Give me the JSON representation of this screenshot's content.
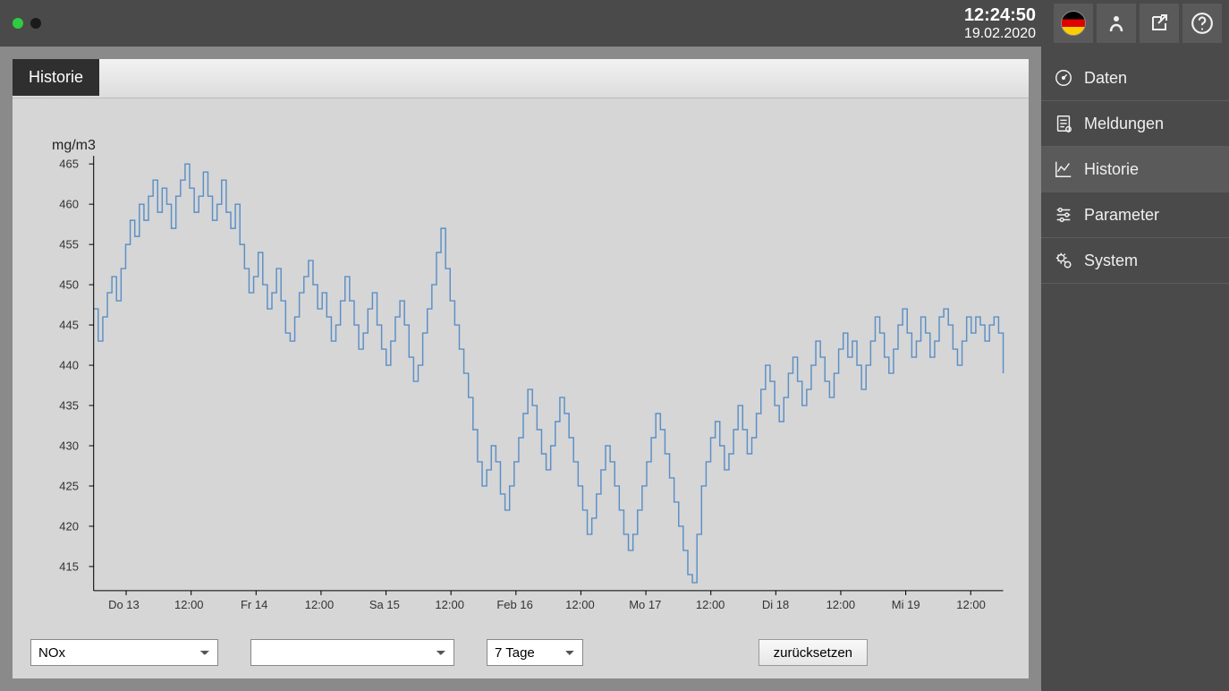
{
  "header": {
    "time": "12:24:50",
    "date": "19.02.2020"
  },
  "sidebar": {
    "items": [
      {
        "label": "Daten"
      },
      {
        "label": "Meldungen"
      },
      {
        "label": "Historie"
      },
      {
        "label": "Parameter"
      },
      {
        "label": "System"
      }
    ]
  },
  "panel": {
    "tab_label": "Historie"
  },
  "controls": {
    "select1": "NOx",
    "select2": "",
    "select3": "7 Tage",
    "reset_label": "zurücksetzen"
  },
  "chart_data": {
    "type": "line",
    "ylabel": "mg/m3",
    "ylim": [
      412,
      466
    ],
    "y_ticks": [
      415,
      420,
      425,
      430,
      435,
      440,
      445,
      450,
      455,
      460,
      465
    ],
    "x_ticks": [
      "Do 13",
      "12:00",
      "Fr 14",
      "12:00",
      "Sa 15",
      "12:00",
      "Feb 16",
      "12:00",
      "Mo 17",
      "12:00",
      "Di 18",
      "12:00",
      "Mi 19",
      "12:00"
    ],
    "x": [
      0,
      1,
      2,
      3,
      4,
      5,
      6,
      7,
      8,
      9,
      10,
      11,
      12,
      13,
      14,
      15,
      16,
      17,
      18,
      19,
      20,
      21,
      22,
      23,
      24,
      25,
      26,
      27,
      28,
      29,
      30,
      31,
      32,
      33,
      34,
      35,
      36,
      37,
      38,
      39,
      40,
      41,
      42,
      43,
      44,
      45,
      46,
      47,
      48,
      49,
      50,
      51,
      52,
      53,
      54,
      55,
      56,
      57,
      58,
      59,
      60,
      61,
      62,
      63,
      64,
      65,
      66,
      67,
      68,
      69,
      70,
      71,
      72,
      73,
      74,
      75,
      76,
      77,
      78,
      79,
      80,
      81,
      82,
      83,
      84,
      85,
      86,
      87,
      88,
      89,
      90,
      91,
      92,
      93,
      94,
      95,
      96,
      97,
      98,
      99,
      100,
      101,
      102,
      103,
      104,
      105,
      106,
      107,
      108,
      109,
      110,
      111,
      112,
      113,
      114,
      115,
      116,
      117,
      118,
      119,
      120,
      121,
      122,
      123,
      124,
      125,
      126,
      127,
      128,
      129,
      130,
      131,
      132,
      133,
      134,
      135,
      136,
      137,
      138,
      139,
      140,
      141,
      142,
      143,
      144,
      145,
      146,
      147,
      148,
      149,
      150,
      151,
      152,
      153,
      154,
      155,
      156,
      157,
      158,
      159,
      160,
      161,
      162,
      163,
      164,
      165,
      166,
      167,
      168,
      169,
      170,
      171,
      172,
      173,
      174,
      175,
      176,
      177,
      178,
      179,
      180,
      181,
      182,
      183,
      184,
      185,
      186,
      187,
      188,
      189,
      190,
      191,
      192,
      193,
      194,
      195,
      196,
      197,
      198,
      199
    ],
    "values": [
      447,
      443,
      446,
      449,
      451,
      448,
      452,
      455,
      458,
      456,
      460,
      458,
      461,
      463,
      459,
      462,
      460,
      457,
      461,
      463,
      465,
      462,
      459,
      461,
      464,
      461,
      458,
      460,
      463,
      459,
      457,
      460,
      455,
      452,
      449,
      451,
      454,
      450,
      447,
      449,
      452,
      448,
      444,
      443,
      446,
      449,
      451,
      453,
      450,
      447,
      449,
      446,
      443,
      445,
      448,
      451,
      448,
      445,
      442,
      444,
      447,
      449,
      445,
      442,
      440,
      443,
      446,
      448,
      445,
      441,
      438,
      440,
      444,
      447,
      450,
      454,
      457,
      452,
      448,
      445,
      442,
      439,
      436,
      432,
      428,
      425,
      427,
      430,
      428,
      424,
      422,
      425,
      428,
      431,
      434,
      437,
      435,
      432,
      429,
      427,
      430,
      433,
      436,
      434,
      431,
      428,
      425,
      422,
      419,
      421,
      424,
      427,
      430,
      428,
      425,
      422,
      419,
      417,
      419,
      422,
      425,
      428,
      431,
      434,
      432,
      429,
      426,
      423,
      420,
      417,
      414,
      413,
      419,
      425,
      428,
      431,
      433,
      430,
      427,
      429,
      432,
      435,
      432,
      429,
      431,
      434,
      437,
      440,
      438,
      435,
      433,
      436,
      439,
      441,
      438,
      435,
      437,
      440,
      443,
      441,
      438,
      436,
      439,
      442,
      444,
      441,
      443,
      440,
      437,
      440,
      443,
      446,
      444,
      441,
      439,
      442,
      445,
      447,
      444,
      441,
      443,
      446,
      444,
      441,
      443,
      446,
      447,
      445,
      442,
      440,
      443,
      446,
      444,
      446,
      445,
      443,
      445,
      446,
      444,
      439
    ]
  }
}
